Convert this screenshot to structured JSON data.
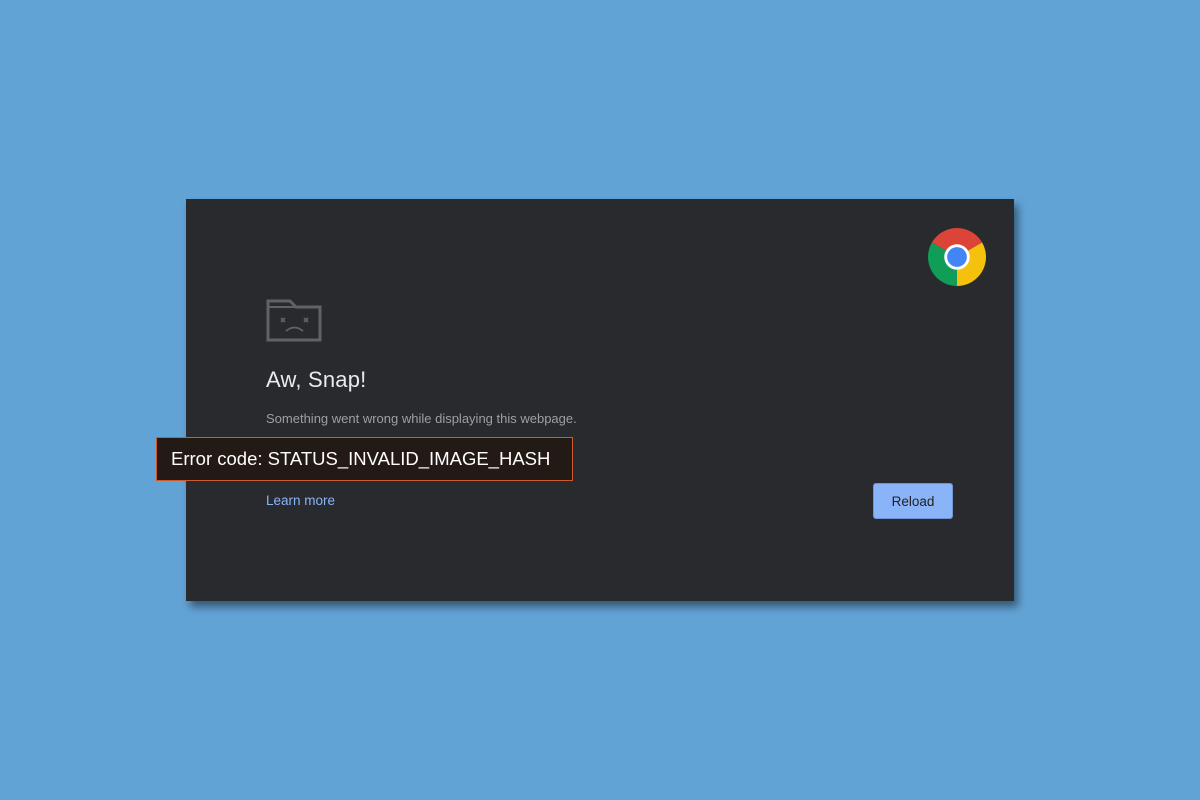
{
  "error_page": {
    "title": "Aw, Snap!",
    "message": "Something went wrong while displaying this webpage.",
    "learn_more_label": "Learn more",
    "reload_label": "Reload",
    "error_code": "Error code: STATUS_INVALID_IMAGE_HASH"
  },
  "icons": {
    "logo": "chrome-logo-icon",
    "sad_tab": "sad-tab-icon"
  },
  "colors": {
    "background": "#62a3d6",
    "panel": "#292a2e",
    "link": "#8ab4f8",
    "button": "#8ab4f8",
    "error_border": "#d05a2a"
  }
}
